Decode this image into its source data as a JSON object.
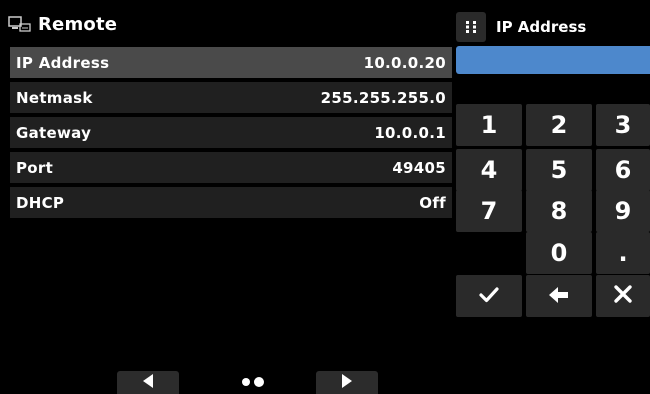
{
  "header": {
    "title": "Remote",
    "icon": "remote-network-icon"
  },
  "settings": {
    "rows": [
      {
        "label": "IP Address",
        "value": "10.0.0.20",
        "selected": true
      },
      {
        "label": "Netmask",
        "value": "255.255.255.0",
        "selected": false
      },
      {
        "label": "Gateway",
        "value": "10.0.0.1",
        "selected": false
      },
      {
        "label": "Port",
        "value": "49405",
        "selected": false
      },
      {
        "label": "DHCP",
        "value": "Off",
        "selected": false
      }
    ]
  },
  "keypad": {
    "title": "IP Address",
    "grip_icon": "drag-grip-icon",
    "display_value": "",
    "display_color": "#4d88cc",
    "keys": {
      "k1": "1",
      "k2": "2",
      "k3": "3",
      "k4": "4",
      "k5": "5",
      "k6": "6",
      "k7": "7",
      "k8": "8",
      "k9": "9",
      "k0": "0",
      "kdot": "."
    },
    "action_icons": [
      "checkmark-icon",
      "backspace-arrow-icon",
      "close-icon"
    ]
  },
  "pager": {
    "prev_icon": "left-arrow-icon",
    "next_icon": "right-arrow-icon",
    "page_indicator": "page-dots-indicator"
  }
}
